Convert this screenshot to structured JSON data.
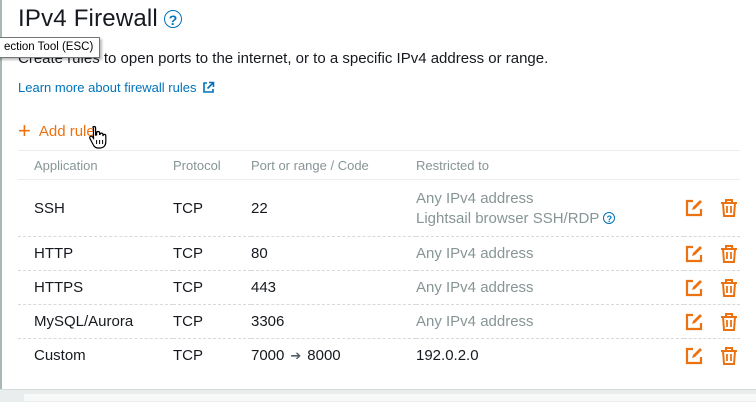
{
  "header": {
    "title": "IPv4 Firewall",
    "help_glyph": "?"
  },
  "description": "Create rules to open ports to the internet, or to a specific IPv4 address or range.",
  "tooltip": "ection Tool (ESC)",
  "learn_link": "Learn more about firewall rules",
  "add_rule": {
    "plus": "+",
    "label": "Add rule"
  },
  "table": {
    "columns": [
      "Application",
      "Protocol",
      "Port or range / Code",
      "Restricted to"
    ],
    "rows": [
      {
        "application": "SSH",
        "protocol": "TCP",
        "port": "22",
        "restricted": "Any IPv4 address",
        "restricted_sub": "Lightsail browser SSH/RDP"
      },
      {
        "application": "HTTP",
        "protocol": "TCP",
        "port": "80",
        "restricted": "Any IPv4 address"
      },
      {
        "application": "HTTPS",
        "protocol": "TCP",
        "port": "443",
        "restricted": "Any IPv4 address"
      },
      {
        "application": "MySQL/Aurora",
        "protocol": "TCP",
        "port": "3306",
        "restricted": "Any IPv4 address"
      },
      {
        "application": "Custom",
        "protocol": "TCP",
        "port_from": "7000",
        "port_to": "8000",
        "restricted": "192.0.2.0"
      }
    ]
  },
  "icons": {
    "edit": "edit-icon",
    "delete": "trash-icon",
    "help": "help-icon",
    "external": "external-link-icon",
    "cursor": "hand-pointer-icon"
  },
  "colors": {
    "accent": "#ec7211",
    "link": "#0073bb",
    "muted": "#879596",
    "text": "#16191f"
  }
}
